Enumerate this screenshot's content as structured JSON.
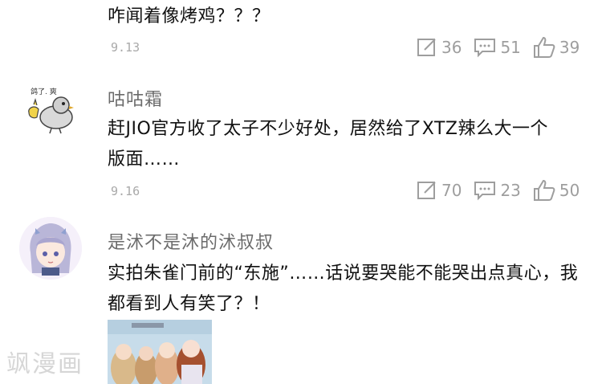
{
  "comments": [
    {
      "text": "咋闻着像烤鸡？？？",
      "time": "9.13",
      "edit_count": "36",
      "reply_count": "51",
      "like_count": "39"
    },
    {
      "username": "咕咕霜",
      "avatar_caption": "鸽了. 爽",
      "text": "赶JIO官方收了太子不少好处，居然给了XTZ辣么大一个版面……",
      "time": "9.16",
      "edit_count": "70",
      "reply_count": "23",
      "like_count": "50"
    },
    {
      "username": "是沭不是沐的沭叔叔",
      "text": "实拍朱雀门前的“东施”……话说要哭能不能哭出点真心，我都看到人有笑了？！"
    }
  ],
  "watermark": "飒漫画",
  "icons": {
    "edit": "edit-icon",
    "reply": "reply-icon",
    "like": "thumbs-up-icon"
  },
  "colors": {
    "text": "#111111",
    "username": "#6b6b6b",
    "meta": "#9e9e9e"
  }
}
